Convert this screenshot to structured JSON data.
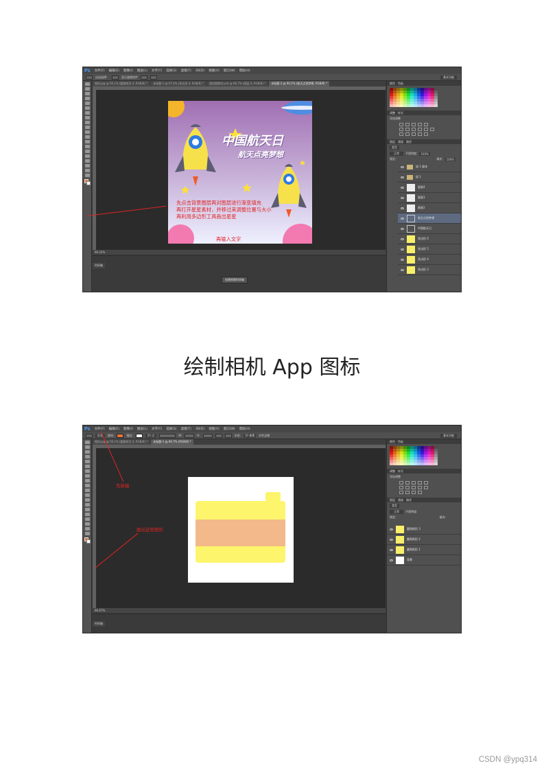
{
  "screenshot1": {
    "menubar": {
      "logo": "Ps",
      "menus": [
        "文件(F)",
        "编辑(E)",
        "图像(I)",
        "图层(L)",
        "文字(Y)",
        "选择(S)",
        "滤镜(T)",
        "3D(D)",
        "视图(V)",
        "窗口(W)",
        "帮助(H)"
      ]
    },
    "optbar": {
      "auto_select": "自动选择：",
      "show_transform": "显示变换控件",
      "workspace": "基本功能"
    },
    "tabs": [
      "相机.jpg @ 56.1% (圆角矩形 4, RGB/8) *",
      "未标题-1 @ 67.4% (多边形 4, RGB/8) *",
      "遥控器素材.psd @ 66.7% (图层 6, RGB/8) *",
      "未标题-2 @ 90.2% (航天点亮梦想, RGB/8) *"
    ],
    "poster": {
      "title": "中国航天日",
      "subtitle": "航天点亮梦想",
      "instructions": [
        "先点击背景图层再对图层进行渐变填充",
        "再打开星星素材，并移过来调整位置与大小",
        "再利用多边形工具画出星星"
      ],
      "input_text": "再输入文字"
    },
    "status": "90.22%",
    "timeline_label": "时间轴",
    "timeline_button": "创建视频时间轴",
    "panels": {
      "swatch_tabs": [
        "颜色",
        "色板"
      ],
      "adjust_tabs": [
        "调整",
        "样式"
      ],
      "adjust_title": "添加调整",
      "layer_tabs": [
        "图层",
        "通道",
        "路径"
      ],
      "kind": "类型",
      "blend": "正常",
      "opacity_label": "不透明度:",
      "opacity": "100%",
      "lock_label": "锁定:",
      "fill_label": "填充:",
      "fill": "100%",
      "layers": [
        {
          "name": "组 1 副本",
          "type": "group",
          "selected": false
        },
        {
          "name": "组 1",
          "type": "group",
          "selected": false
        },
        {
          "name": "星星4",
          "type": "image",
          "selected": false
        },
        {
          "name": "星星3",
          "type": "image",
          "selected": false
        },
        {
          "name": "星星2",
          "type": "image",
          "selected": false
        },
        {
          "name": "航天点亮梦想",
          "type": "text",
          "selected": true
        },
        {
          "name": "中国航天日",
          "type": "text",
          "selected": false
        },
        {
          "name": "多边形 6",
          "type": "shape",
          "selected": false
        },
        {
          "name": "多边形 5",
          "type": "shape",
          "selected": false
        },
        {
          "name": "多边形 4",
          "type": "shape",
          "selected": false
        },
        {
          "name": "多边形 3",
          "type": "shape",
          "selected": false
        }
      ]
    }
  },
  "caption": "绘制相机 App 图标",
  "screenshot2": {
    "menubar": {
      "logo": "Ps",
      "menus": [
        "文件(F)",
        "编辑(E)",
        "图像(I)",
        "图层(L)",
        "文字(Y)",
        "选择(S)",
        "滤镜(T)",
        "3D(D)",
        "视图(V)",
        "窗口(W)",
        "帮助(H)"
      ]
    },
    "optbar": {
      "shape": "形状",
      "fill": "填充:",
      "stroke": "描边:",
      "stroke_width": "20 点",
      "w_label": "W:",
      "h_label": "H:",
      "radius_label": "半径:",
      "radius": "10 像素",
      "align_edges": "对齐边缘",
      "workspace": "基本功能"
    },
    "tabs": [
      "相机.jpg @ 56.1% (圆角矩形 4, RGB/8) *",
      "未标题-1 @ 66.7% (RGB/8) *"
    ],
    "annotations": {
      "new": "先新建",
      "draw": "画出这些图形"
    },
    "status": "66.67%",
    "timeline_label": "时间轴",
    "panels": {
      "swatch_tabs": [
        "颜色",
        "色板"
      ],
      "adjust_tabs": [
        "调整",
        "样式"
      ],
      "adjust_title": "添加调整",
      "layer_tabs": [
        "图层",
        "通道",
        "路径"
      ],
      "kind": "类型",
      "blend": "正常",
      "opacity_label": "不透明度:",
      "lock_label": "锁定:",
      "fill_label": "填充:",
      "layers": [
        {
          "name": "圆角矩形 3",
          "type": "shape",
          "color": "#f7ef6a"
        },
        {
          "name": "圆角矩形 2",
          "type": "shape",
          "color": "#f7ef6a"
        },
        {
          "name": "圆角矩形 1",
          "type": "shape",
          "color": "#f7ef6a"
        },
        {
          "name": "背景",
          "type": "background",
          "color": "#ffffff"
        }
      ]
    }
  },
  "footer": "CSDN @ypq314",
  "colors": {
    "ps_bg": "#3a3a3a",
    "annotation_red": "#e02424",
    "camera_yellow": "#fdf56b",
    "camera_band": "#f3b98a"
  }
}
